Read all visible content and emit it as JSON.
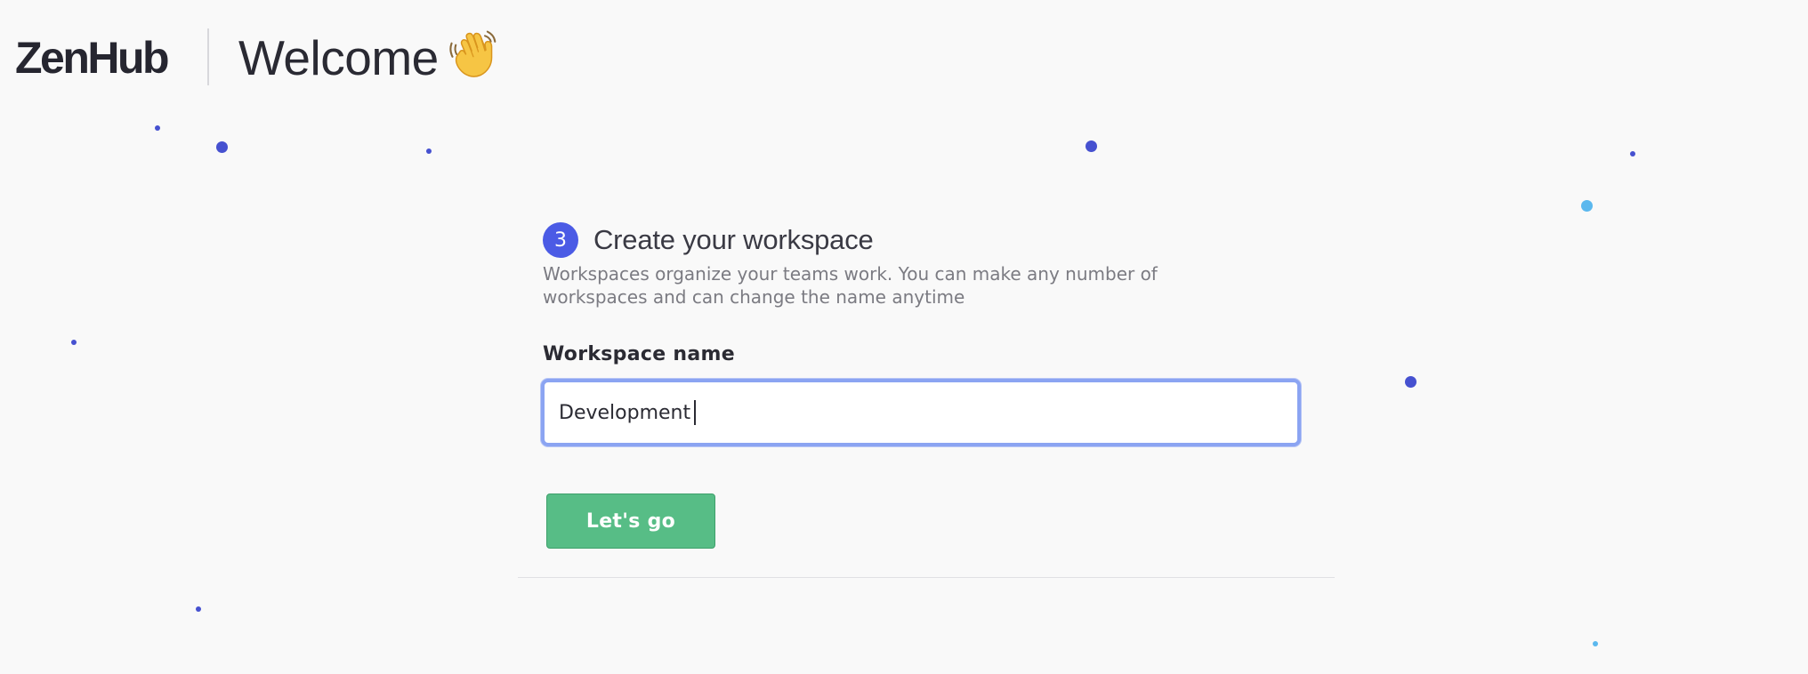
{
  "header": {
    "logo_text": "ZenHub",
    "title": "Welcome",
    "title_icon": "waving-hand-icon"
  },
  "step": {
    "number": "3",
    "title": "Create your workspace",
    "description": "Workspaces organize your teams work. You can make any number of workspaces and can change the name anytime"
  },
  "form": {
    "label": "Workspace name",
    "input_value": "Development",
    "submit_label": "Let's go"
  },
  "colors": {
    "accent": "#4b5be5",
    "button_green": "#57bd86",
    "focus_ring": "#8ba4f2",
    "dot_blue": "#4651d0",
    "dot_light_blue": "#5bb8ee"
  }
}
